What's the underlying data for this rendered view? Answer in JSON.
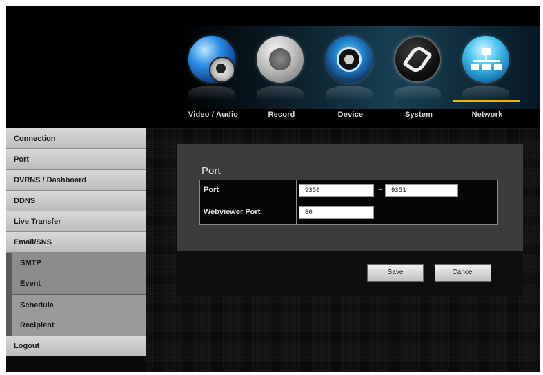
{
  "top_nav": {
    "items": [
      {
        "label": "Video / Audio",
        "icon": "video-audio-icon",
        "selected": false
      },
      {
        "label": "Record",
        "icon": "record-icon",
        "selected": false
      },
      {
        "label": "Device",
        "icon": "device-icon",
        "selected": false
      },
      {
        "label": "System",
        "icon": "system-icon",
        "selected": false
      },
      {
        "label": "Network",
        "icon": "network-icon",
        "selected": true
      }
    ],
    "accent_color": "#f0b400"
  },
  "sidebar": {
    "items": [
      {
        "label": "Connection"
      },
      {
        "label": "Port"
      },
      {
        "label": "DVRNS / Dashboard"
      },
      {
        "label": "DDNS"
      },
      {
        "label": "Live Transfer"
      },
      {
        "label": "Email/SNS"
      },
      {
        "label": "SMTP"
      },
      {
        "label": "Event"
      },
      {
        "label": "Schedule"
      },
      {
        "label": "Recipient"
      },
      {
        "label": "Logout"
      }
    ]
  },
  "port_panel": {
    "title": "Port",
    "rows": [
      {
        "label": "Port",
        "value_from": "9350",
        "separator": "~",
        "value_to": "9351"
      },
      {
        "label": "Webviewer Port",
        "value": "80"
      }
    ]
  },
  "actions": {
    "save_label": "Save",
    "cancel_label": "Cancel"
  }
}
